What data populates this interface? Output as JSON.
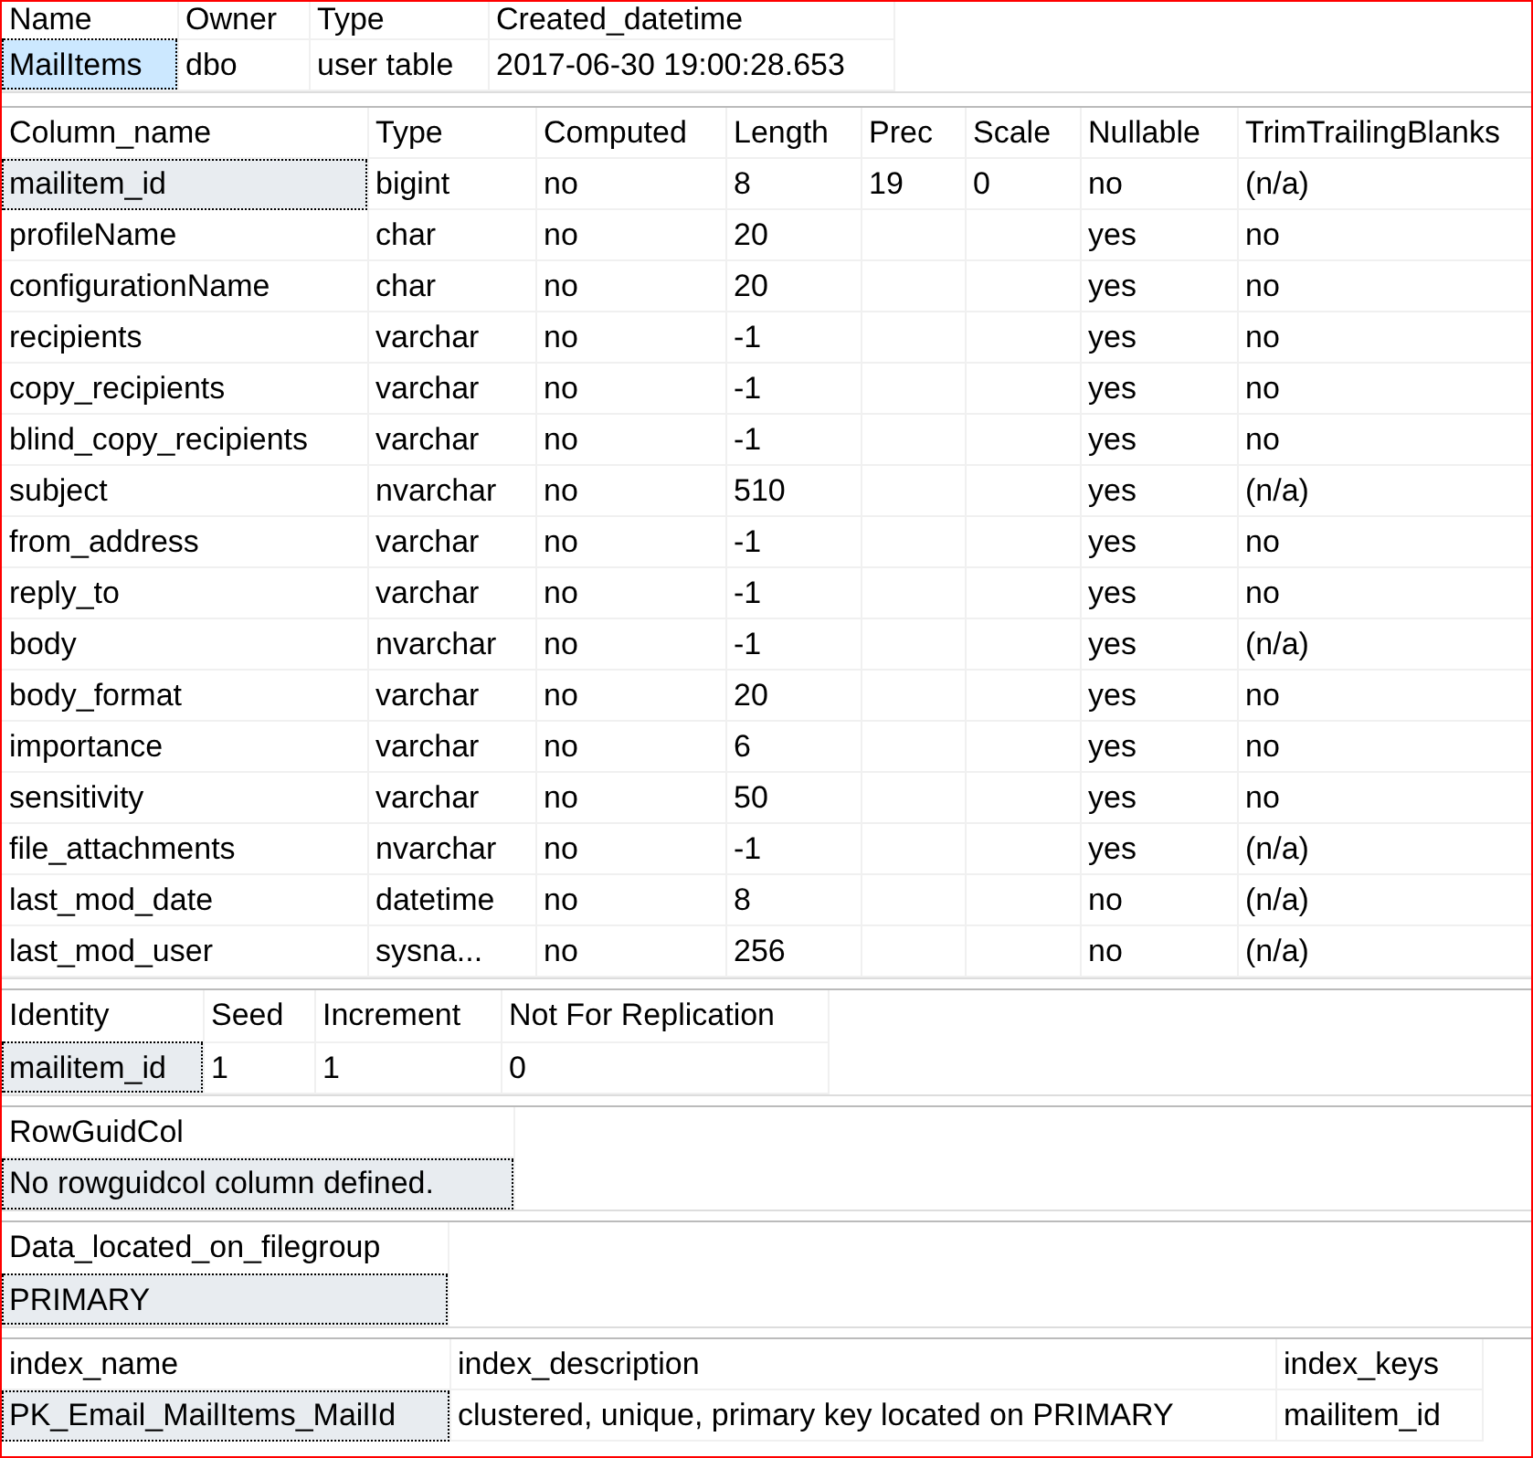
{
  "grids": [
    {
      "focused": true,
      "columns": [
        "Name",
        "Owner",
        "Type",
        "Created_datetime"
      ],
      "rows": [
        [
          {
            "text": "MailItems",
            "selected": true
          },
          {
            "text": "dbo",
            "selected": false
          },
          {
            "text": "user table",
            "selected": false
          },
          {
            "text": "2017-06-30 19:00:28.653",
            "selected": false
          }
        ]
      ]
    },
    {
      "focused": false,
      "columns": [
        "Column_name",
        "Type",
        "Computed",
        "Length",
        "Prec",
        "Scale",
        "Nullable",
        "TrimTrailingBlanks"
      ],
      "rows": [
        [
          {
            "text": "mailitem_id",
            "selected": true
          },
          {
            "text": "bigint",
            "selected": false
          },
          {
            "text": "no",
            "selected": false
          },
          {
            "text": "8",
            "selected": false
          },
          {
            "text": "19",
            "selected": false
          },
          {
            "text": "0",
            "selected": false
          },
          {
            "text": "no",
            "selected": false
          },
          {
            "text": "(n/a)",
            "selected": false
          }
        ],
        [
          {
            "text": "profileName",
            "selected": false
          },
          {
            "text": "char",
            "selected": false
          },
          {
            "text": "no",
            "selected": false
          },
          {
            "text": "20",
            "selected": false
          },
          {
            "selected": false
          },
          {
            "selected": false
          },
          {
            "text": "yes",
            "selected": false
          },
          {
            "text": "no",
            "selected": false
          }
        ],
        [
          {
            "text": "configurationName",
            "selected": false
          },
          {
            "text": "char",
            "selected": false
          },
          {
            "text": "no",
            "selected": false
          },
          {
            "text": "20",
            "selected": false
          },
          {
            "selected": false
          },
          {
            "selected": false
          },
          {
            "text": "yes",
            "selected": false
          },
          {
            "text": "no",
            "selected": false
          }
        ],
        [
          {
            "text": "recipients",
            "selected": false
          },
          {
            "text": "varchar",
            "selected": false
          },
          {
            "text": "no",
            "selected": false
          },
          {
            "text": "-1",
            "selected": false
          },
          {
            "selected": false
          },
          {
            "selected": false
          },
          {
            "text": "yes",
            "selected": false
          },
          {
            "text": "no",
            "selected": false
          }
        ],
        [
          {
            "text": "copy_recipients",
            "selected": false
          },
          {
            "text": "varchar",
            "selected": false
          },
          {
            "text": "no",
            "selected": false
          },
          {
            "text": "-1",
            "selected": false
          },
          {
            "selected": false
          },
          {
            "selected": false
          },
          {
            "text": "yes",
            "selected": false
          },
          {
            "text": "no",
            "selected": false
          }
        ],
        [
          {
            "text": "blind_copy_recipients",
            "selected": false
          },
          {
            "text": "varchar",
            "selected": false
          },
          {
            "text": "no",
            "selected": false
          },
          {
            "text": "-1",
            "selected": false
          },
          {
            "selected": false
          },
          {
            "selected": false
          },
          {
            "text": "yes",
            "selected": false
          },
          {
            "text": "no",
            "selected": false
          }
        ],
        [
          {
            "text": "subject",
            "selected": false
          },
          {
            "text": "nvarchar",
            "selected": false
          },
          {
            "text": "no",
            "selected": false
          },
          {
            "text": "510",
            "selected": false
          },
          {
            "selected": false
          },
          {
            "selected": false
          },
          {
            "text": "yes",
            "selected": false
          },
          {
            "text": "(n/a)",
            "selected": false
          }
        ],
        [
          {
            "text": "from_address",
            "selected": false
          },
          {
            "text": "varchar",
            "selected": false
          },
          {
            "text": "no",
            "selected": false
          },
          {
            "text": "-1",
            "selected": false
          },
          {
            "selected": false
          },
          {
            "selected": false
          },
          {
            "text": "yes",
            "selected": false
          },
          {
            "text": "no",
            "selected": false
          }
        ],
        [
          {
            "text": "reply_to",
            "selected": false
          },
          {
            "text": "varchar",
            "selected": false
          },
          {
            "text": "no",
            "selected": false
          },
          {
            "text": "-1",
            "selected": false
          },
          {
            "selected": false
          },
          {
            "selected": false
          },
          {
            "text": "yes",
            "selected": false
          },
          {
            "text": "no",
            "selected": false
          }
        ],
        [
          {
            "text": "body",
            "selected": false
          },
          {
            "text": "nvarchar",
            "selected": false
          },
          {
            "text": "no",
            "selected": false
          },
          {
            "text": "-1",
            "selected": false
          },
          {
            "selected": false
          },
          {
            "selected": false
          },
          {
            "text": "yes",
            "selected": false
          },
          {
            "text": "(n/a)",
            "selected": false
          }
        ],
        [
          {
            "text": "body_format",
            "selected": false
          },
          {
            "text": "varchar",
            "selected": false
          },
          {
            "text": "no",
            "selected": false
          },
          {
            "text": "20",
            "selected": false
          },
          {
            "selected": false
          },
          {
            "selected": false
          },
          {
            "text": "yes",
            "selected": false
          },
          {
            "text": "no",
            "selected": false
          }
        ],
        [
          {
            "text": "importance",
            "selected": false
          },
          {
            "text": "varchar",
            "selected": false
          },
          {
            "text": "no",
            "selected": false
          },
          {
            "text": "6",
            "selected": false
          },
          {
            "selected": false
          },
          {
            "selected": false
          },
          {
            "text": "yes",
            "selected": false
          },
          {
            "text": "no",
            "selected": false
          }
        ],
        [
          {
            "text": "sensitivity",
            "selected": false
          },
          {
            "text": "varchar",
            "selected": false
          },
          {
            "text": "no",
            "selected": false
          },
          {
            "text": "50",
            "selected": false
          },
          {
            "selected": false
          },
          {
            "selected": false
          },
          {
            "text": "yes",
            "selected": false
          },
          {
            "text": "no",
            "selected": false
          }
        ],
        [
          {
            "text": "file_attachments",
            "selected": false
          },
          {
            "text": "nvarchar",
            "selected": false
          },
          {
            "text": "no",
            "selected": false
          },
          {
            "text": "-1",
            "selected": false
          },
          {
            "selected": false
          },
          {
            "selected": false
          },
          {
            "text": "yes",
            "selected": false
          },
          {
            "text": "(n/a)",
            "selected": false
          }
        ],
        [
          {
            "text": "last_mod_date",
            "selected": false
          },
          {
            "text": "datetime",
            "selected": false
          },
          {
            "text": "no",
            "selected": false
          },
          {
            "text": "8",
            "selected": false
          },
          {
            "selected": false
          },
          {
            "selected": false
          },
          {
            "text": "no",
            "selected": false
          },
          {
            "text": "(n/a)",
            "selected": false
          }
        ],
        [
          {
            "text": "last_mod_user",
            "selected": false
          },
          {
            "text": "sysna...",
            "selected": false
          },
          {
            "text": "no",
            "selected": false
          },
          {
            "text": "256",
            "selected": false
          },
          {
            "selected": false
          },
          {
            "selected": false
          },
          {
            "text": "no",
            "selected": false
          },
          {
            "text": "(n/a)",
            "selected": false
          }
        ]
      ]
    },
    {
      "focused": false,
      "columns": [
        "Identity",
        "Seed",
        "Increment",
        "Not For Replication"
      ],
      "rows": [
        [
          {
            "text": "mailitem_id",
            "selected": true
          },
          {
            "text": "1",
            "selected": false
          },
          {
            "text": "1",
            "selected": false
          },
          {
            "text": "0",
            "selected": false
          }
        ]
      ]
    },
    {
      "focused": false,
      "columns": [
        "RowGuidCol"
      ],
      "rows": [
        [
          {
            "text": "No rowguidcol column defined.",
            "selected": true
          }
        ]
      ]
    },
    {
      "focused": false,
      "columns": [
        "Data_located_on_filegroup"
      ],
      "rows": [
        [
          {
            "text": "PRIMARY",
            "selected": true
          }
        ]
      ]
    },
    {
      "focused": false,
      "columns": [
        "index_name",
        "index_description",
        "index_keys"
      ],
      "rows": [
        [
          {
            "text": "PK_Email_MailItems_MailId",
            "selected": true
          },
          {
            "text": "clustered, unique, primary key located on PRIMARY",
            "selected": false
          },
          {
            "text": "mailitem_id",
            "selected": false
          }
        ]
      ]
    }
  ]
}
